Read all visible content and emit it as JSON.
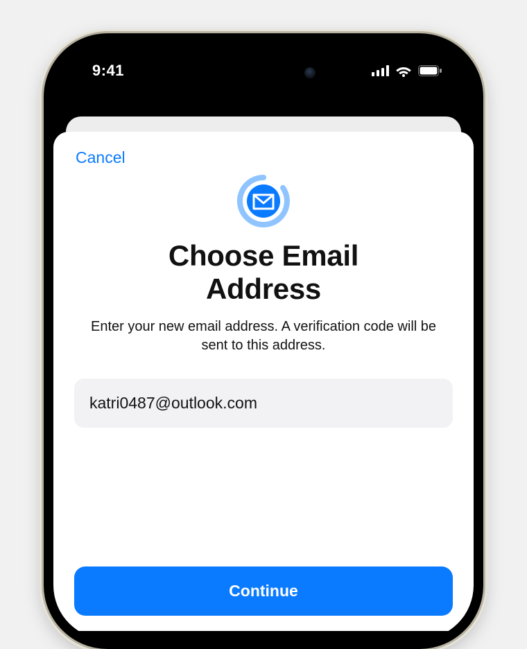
{
  "status": {
    "time": "9:41"
  },
  "nav": {
    "cancel_label": "Cancel"
  },
  "page": {
    "title_line1": "Choose Email",
    "title_line2": "Address",
    "subtitle": "Enter your new email address. A verification code will be sent to this address."
  },
  "form": {
    "email_value": "katri0487@outlook.com",
    "continue_label": "Continue"
  },
  "colors": {
    "accent": "#0a7aff"
  }
}
